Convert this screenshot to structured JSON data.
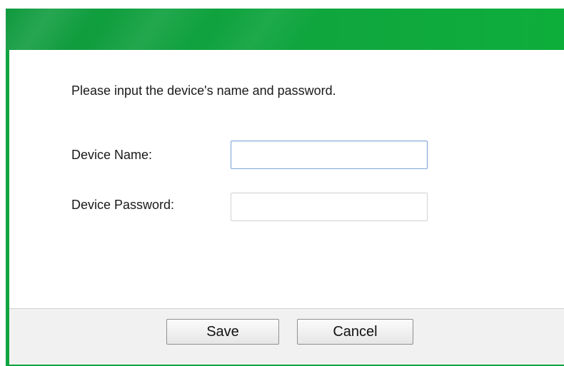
{
  "dialog": {
    "instruction": "Please input the device's name and password.",
    "fields": {
      "device_name": {
        "label": "Device Name:",
        "value": "",
        "placeholder": ""
      },
      "device_password": {
        "label": "Device Password:",
        "value": "",
        "placeholder": ""
      }
    },
    "buttons": {
      "save_label": "Save",
      "cancel_label": "Cancel"
    }
  },
  "colors": {
    "header_green": "#10a43f",
    "focus_border": "#7ea6d8",
    "footer_background": "#f1f1f1"
  }
}
